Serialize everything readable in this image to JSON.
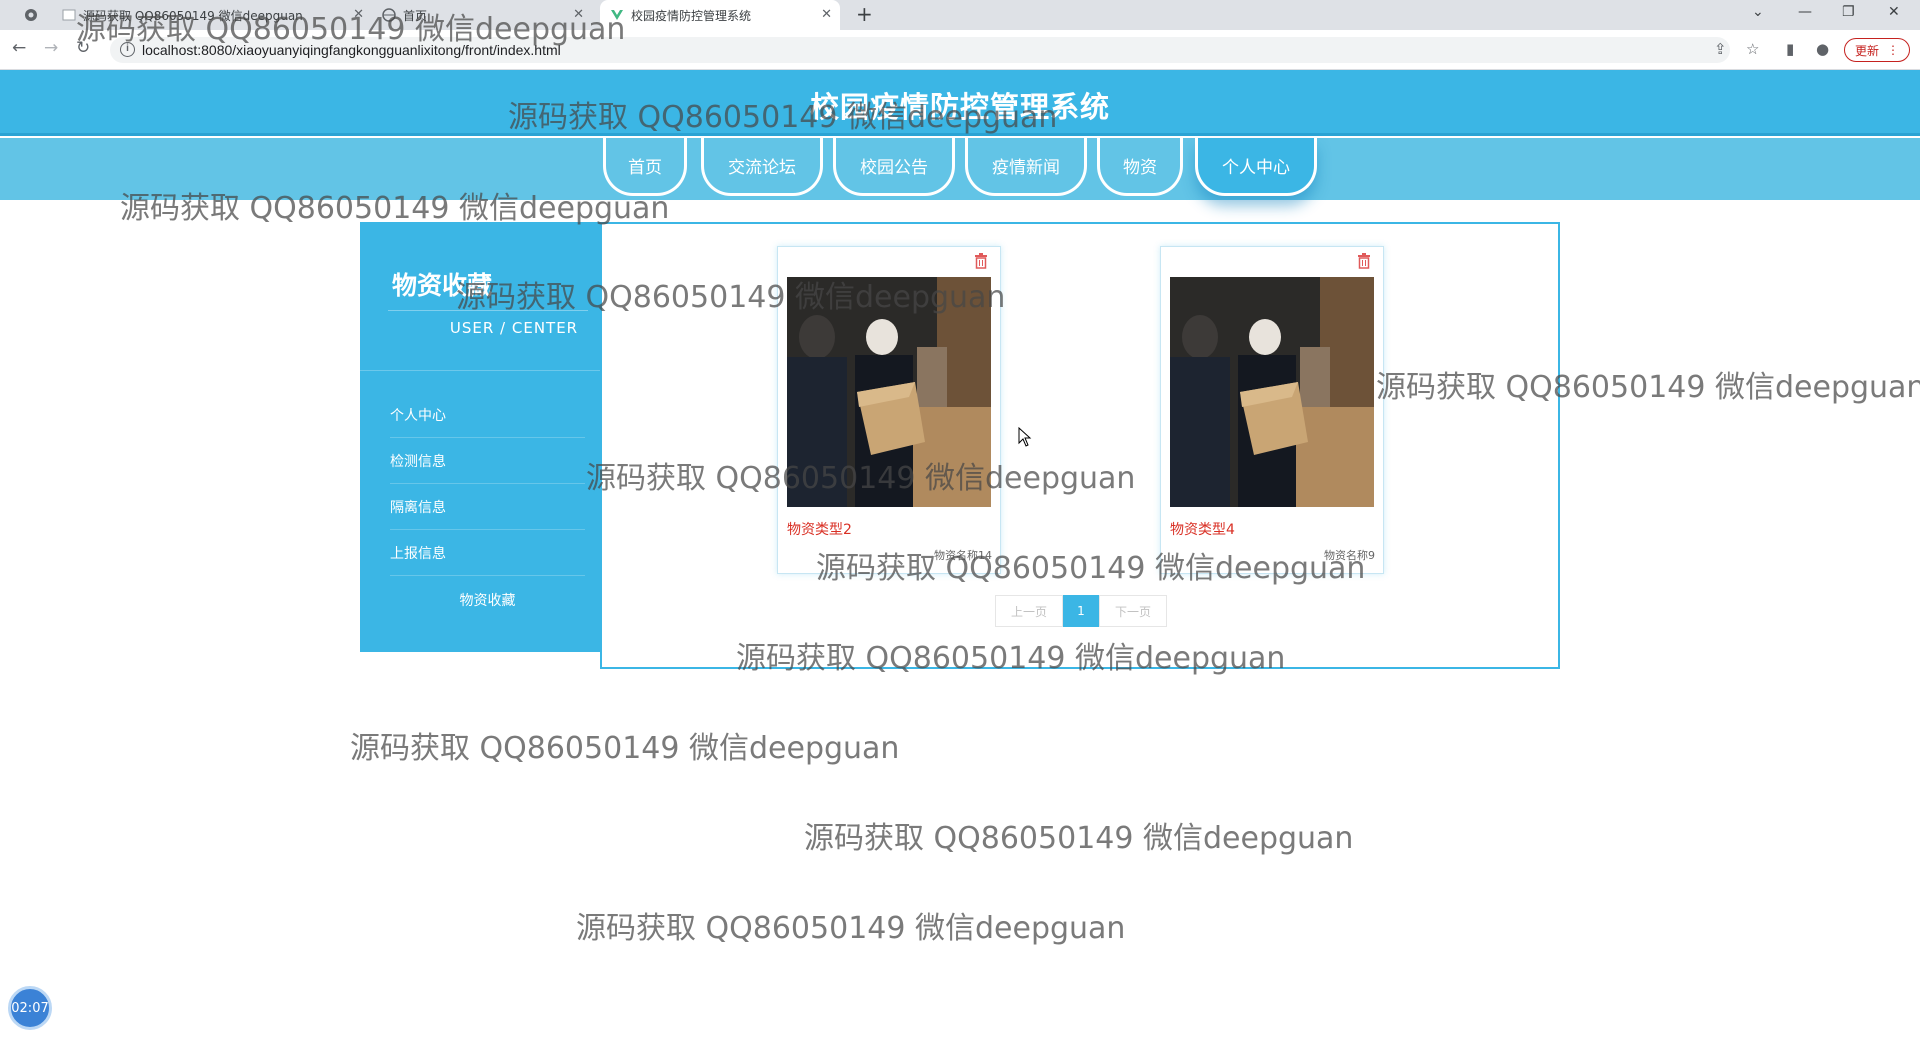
{
  "browser": {
    "tabs": [
      {
        "title": "源码获取 QQ86050149 微信deepguan",
        "active": false
      },
      {
        "title": "首页",
        "active": false
      },
      {
        "title": "校园疫情防控管理系统",
        "active": true
      }
    ],
    "url": "localhost:8080/xiaoyuanyiqingfangkongguanlixitong/front/index.html",
    "update_label": "更新"
  },
  "site": {
    "title": "校园疫情防控管理系统",
    "nav": [
      "首页",
      "交流论坛",
      "校园公告",
      "疫情新闻",
      "物资",
      "个人中心"
    ],
    "active_nav": "个人中心"
  },
  "sidebar": {
    "title": "物资收藏",
    "subtitle": "USER / CENTER",
    "items": [
      "个人中心",
      "检测信息",
      "隔离信息",
      "上报信息",
      "物资收藏"
    ],
    "active_item": "物资收藏"
  },
  "cards": [
    {
      "type": "物资类型2",
      "name": "物资名称14"
    },
    {
      "type": "物资类型4",
      "name": "物资名称9"
    }
  ],
  "pagination": {
    "prev": "上一页",
    "current": "1",
    "next": "下一页"
  },
  "watermark": "源码获取 QQ86050149 微信deepguan",
  "timer": "02:07",
  "colors": {
    "primary": "#3bb6e5",
    "nav_strip": "#62c4e6",
    "card_type": "#d93025"
  }
}
